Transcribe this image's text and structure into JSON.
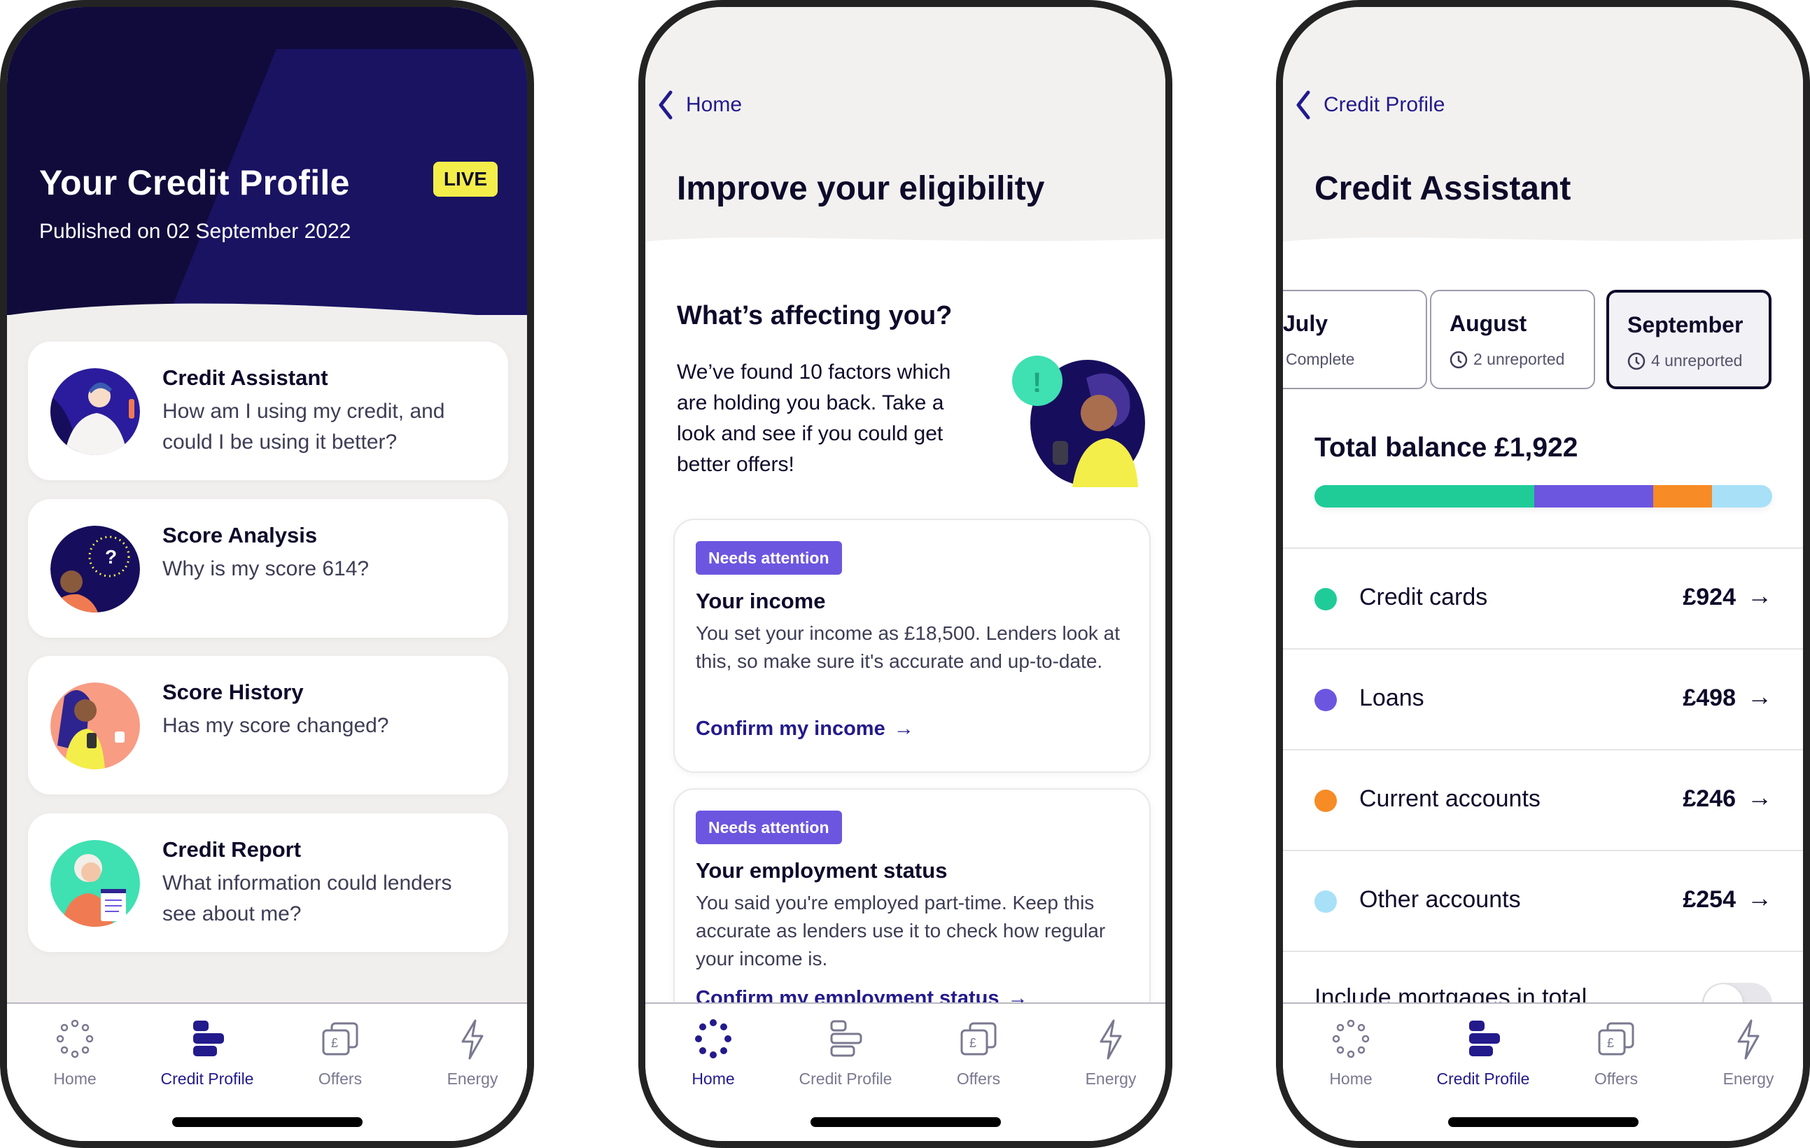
{
  "phone1": {
    "header": {
      "title": "Your Credit Profile",
      "badge": "LIVE",
      "published": "Published on 02 September 2022"
    },
    "cards": [
      {
        "title": "Credit Assistant",
        "description": "How am I using my credit, and could I be using it better?",
        "illustration": "person-hand-on-chest-illustration"
      },
      {
        "title": "Score Analysis",
        "description": "Why is my score 614?",
        "illustration": "person-question-mark-illustration"
      },
      {
        "title": "Score History",
        "description": "Has my score changed?",
        "illustration": "person-phone-mug-illustration"
      },
      {
        "title": "Credit Report",
        "description": "What information could lenders see about me?",
        "illustration": "person-holding-report-illustration"
      }
    ],
    "active_tab": "Credit Profile"
  },
  "phone2": {
    "back_label": "Home",
    "title": "Improve your eligibility",
    "section_title": "What’s affecting you?",
    "intro": "We’ve found 10 factors which are holding you back. Take a look and see if you could get better offers!",
    "factors": [
      {
        "badge": "Needs attention",
        "title": "Your income",
        "description": "You set your income as £18,500. Lenders look at this, so make sure it's accurate and up-to-date.",
        "link": "Confirm my income",
        "link_arrow": "→"
      },
      {
        "badge": "Needs attention",
        "title": "Your employment status",
        "description": "You said you're employed part-time. Keep this accurate as lenders use it to check how regular your income is.",
        "link": "Confirm my employment status",
        "link_arrow": "→"
      }
    ],
    "active_tab": "Home"
  },
  "phone3": {
    "back_label": "Credit Profile",
    "title": "Credit Assistant",
    "months": [
      {
        "name": "July",
        "status": "Complete",
        "status_icon": "check-icon",
        "selected": false
      },
      {
        "name": "August",
        "status": "2 unreported",
        "status_icon": "clock-icon",
        "selected": false
      },
      {
        "name": "September",
        "status": "4 unreported",
        "status_icon": "clock-icon",
        "selected": true
      }
    ],
    "total_label": "Total balance £1,922",
    "total_value": 1922,
    "accounts": [
      {
        "name": "Credit cards",
        "value_label": "£924",
        "value": 924,
        "color": "#1fcc98"
      },
      {
        "name": "Loans",
        "value_label": "£498",
        "value": 498,
        "color": "#6c56e0"
      },
      {
        "name": "Current accounts",
        "value_label": "£246",
        "value": 246,
        "color": "#f78b25"
      },
      {
        "name": "Other accounts",
        "value_label": "£254",
        "value": 254,
        "color": "#a8e0f8"
      }
    ],
    "arrow": "→",
    "mortgage_toggle": {
      "label": "Include mortgages in total",
      "on": false
    },
    "active_tab": "Credit Profile"
  },
  "tabs": [
    {
      "label": "Home",
      "icon": "home-dots-icon"
    },
    {
      "label": "Credit Profile",
      "icon": "credit-profile-bars-icon"
    },
    {
      "label": "Offers",
      "icon": "offers-pound-cards-icon"
    },
    {
      "label": "Energy",
      "icon": "energy-bolt-icon"
    }
  ],
  "colors": {
    "brand_dark": "#110b3c",
    "accent": "#231a8c",
    "badge_purple": "#6c56e0",
    "live_yellow": "#f4ee4a",
    "inactive_gray": "#7a7990"
  }
}
